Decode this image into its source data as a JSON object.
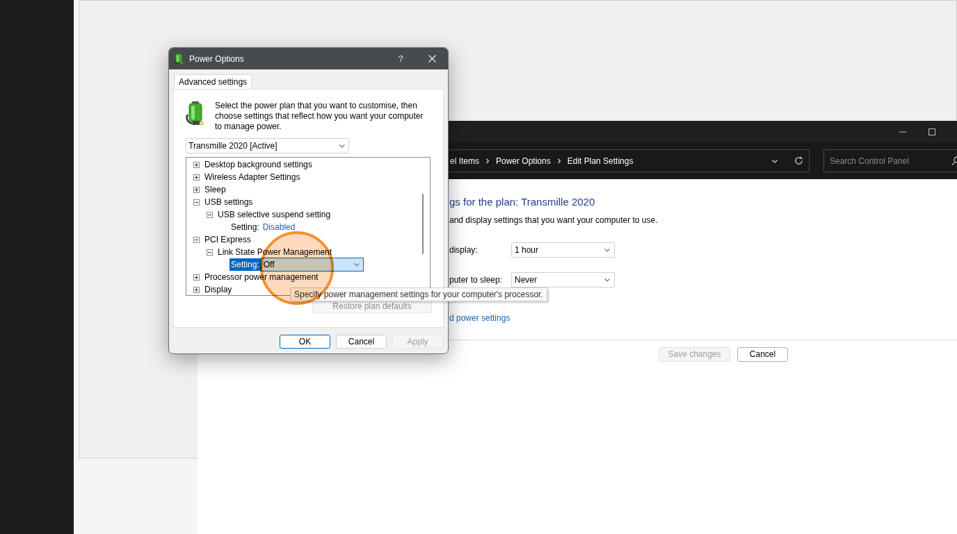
{
  "control_panel": {
    "breadcrumb": [
      "el Items",
      "Power Options",
      "Edit Plan Settings"
    ],
    "search": {
      "placeholder": "Search Control Panel"
    },
    "heading": "gs for the plan: Transmille 2020",
    "description": "and display settings that you want your computer to use.",
    "settings": [
      {
        "label": "display:",
        "value": "1 hour"
      },
      {
        "label": "puter to sleep:",
        "value": "Never"
      }
    ],
    "link": "d power settings",
    "buttons": [
      {
        "label": "Save changes",
        "disabled": true
      },
      {
        "label": "Cancel",
        "disabled": false
      }
    ]
  },
  "dialog": {
    "title": "Power Options",
    "help": "?",
    "tabs": [
      {
        "label": "Advanced settings",
        "selected": true
      }
    ],
    "intro": "Select the power plan that you want to customise, then choose settings that reflect how you want your computer to manage power.",
    "plan_select": {
      "value": "Transmille 2020 [Active]"
    },
    "tree": [
      {
        "label": "Desktop background settings",
        "expanded": false
      },
      {
        "label": "Wireless Adapter Settings",
        "expanded": false
      },
      {
        "label": "Sleep",
        "expanded": false
      },
      {
        "label": "USB settings",
        "expanded": true,
        "children": [
          {
            "label": "USB selective suspend setting",
            "expanded": true,
            "children": [
              {
                "kind": "link",
                "label": "Setting:",
                "value": "Disabled",
                "selected": false
              }
            ]
          }
        ]
      },
      {
        "label": "PCI Express",
        "expanded": true,
        "children": [
          {
            "label": "Link State Power Management",
            "expanded": true,
            "children": [
              {
                "kind": "dropdown",
                "label": "Setting:",
                "value": "Off",
                "selected": true
              }
            ]
          }
        ]
      },
      {
        "label": "Processor power management",
        "expanded": false
      },
      {
        "label": "Display",
        "expanded": false
      }
    ],
    "restore_button": {
      "label": "Restore plan defaults",
      "disabled": true
    },
    "buttons": [
      {
        "label": "OK",
        "disabled": false,
        "default": true
      },
      {
        "label": "Cancel",
        "disabled": false,
        "default": false
      },
      {
        "label": "Apply",
        "disabled": true,
        "default": false
      }
    ]
  },
  "tooltip": "Specify power management settings for your computer's processor."
}
